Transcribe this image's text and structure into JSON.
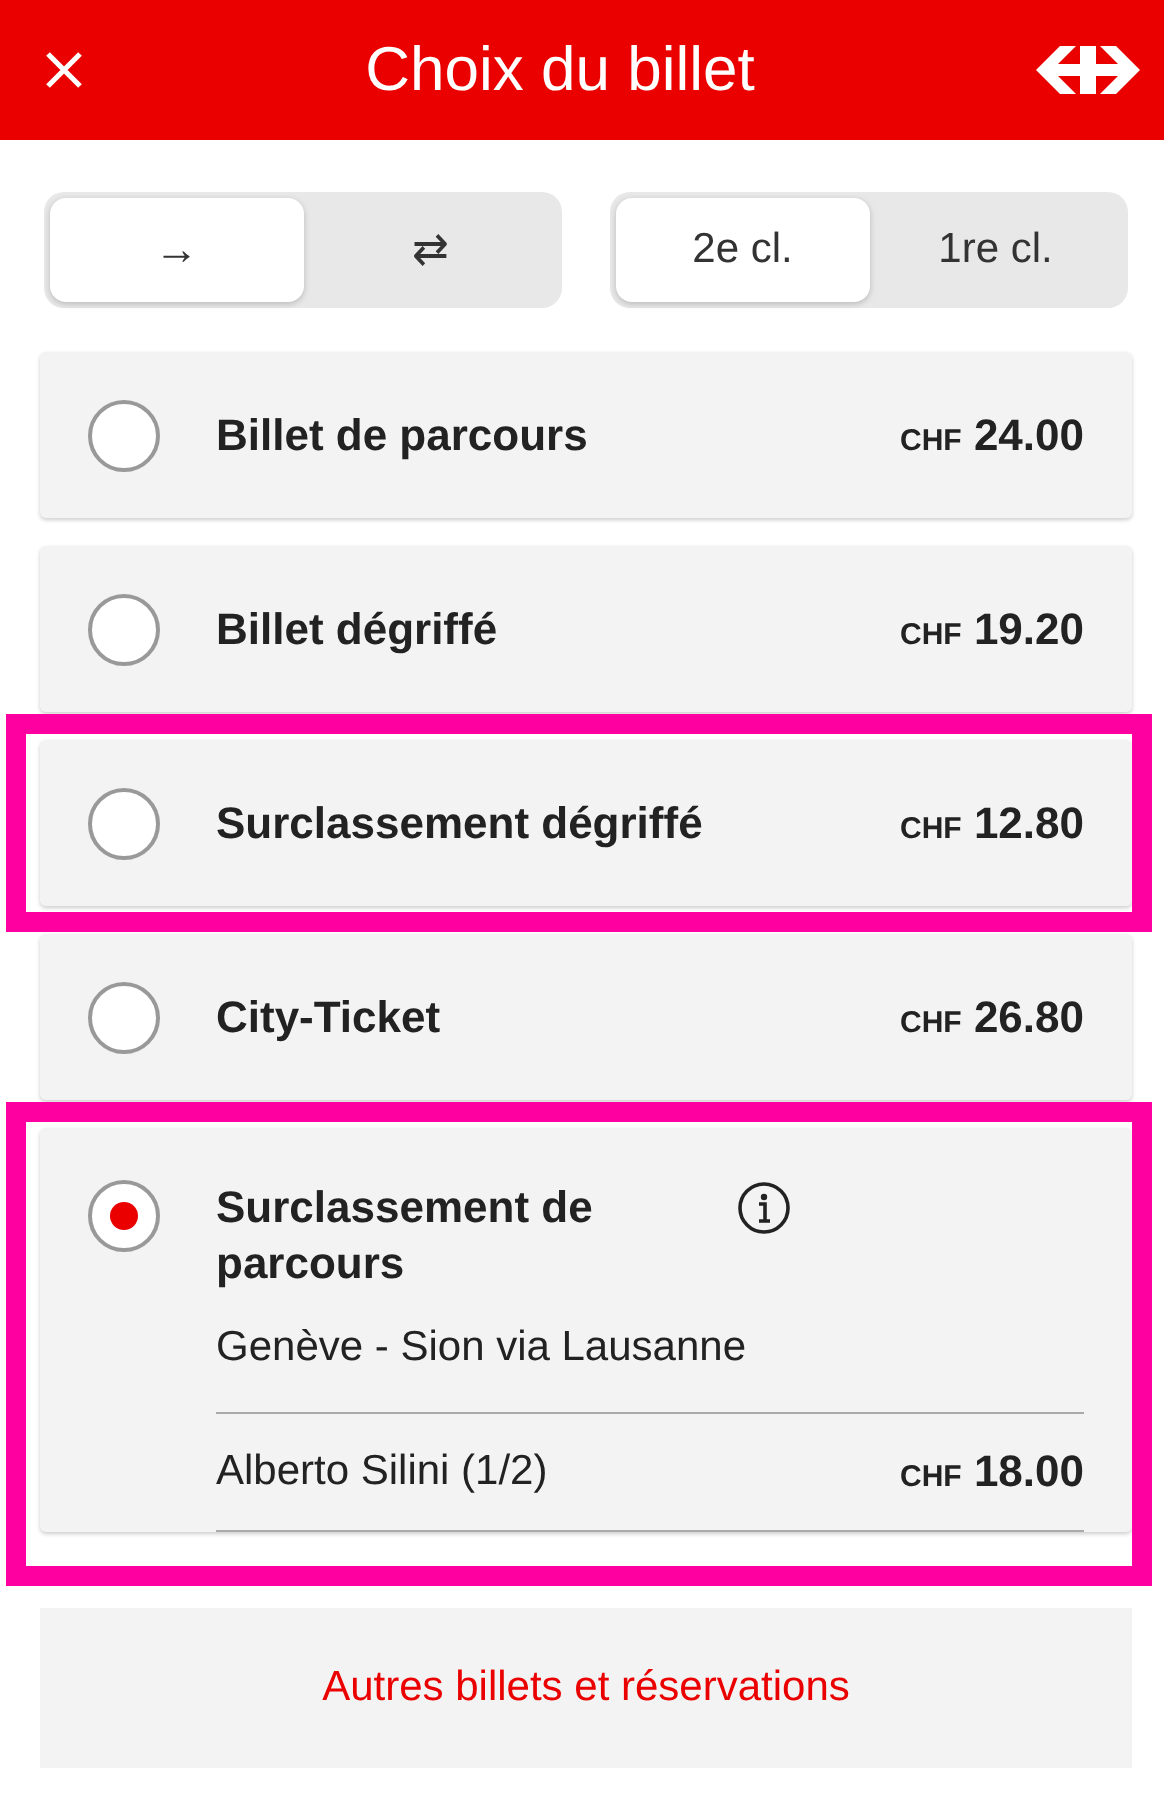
{
  "header": {
    "title": "Choix du billet"
  },
  "direction": [
    {
      "label": "→",
      "selected": true
    },
    {
      "label": "⇄",
      "selected": false
    }
  ],
  "travel_class": [
    {
      "label": "2e cl.",
      "selected": true
    },
    {
      "label": "1re cl.",
      "selected": false
    }
  ],
  "tickets": [
    {
      "name": "Billet de parcours",
      "currency": "CHF",
      "price": "24.00",
      "selected": false,
      "highlighted": false
    },
    {
      "name": "Billet dégriffé",
      "currency": "CHF",
      "price": "19.20",
      "selected": false,
      "highlighted": false
    },
    {
      "name": "Surclassement dégriffé",
      "currency": "CHF",
      "price": "12.80",
      "selected": false,
      "highlighted": true
    },
    {
      "name": "City-Ticket",
      "currency": "CHF",
      "price": "26.80",
      "selected": false,
      "highlighted": false
    },
    {
      "name": "Surclassement de parcours",
      "currency": "CHF",
      "price": "18.00",
      "selected": true,
      "highlighted": true,
      "route": "Genève - Sion via Lausanne",
      "passenger": "Alberto Silini (1/2)"
    }
  ],
  "more_link": "Autres billets et réservations"
}
